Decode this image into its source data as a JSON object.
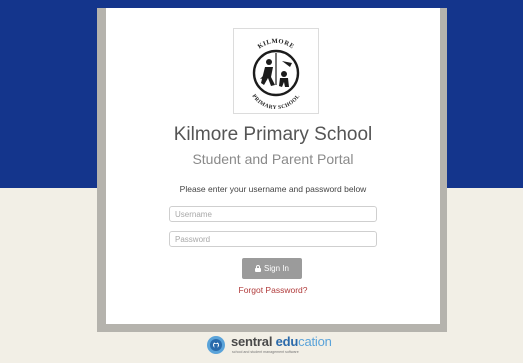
{
  "school": {
    "logo_lettering": [
      "KILMORE",
      "PRIMARY",
      "SCHOOL"
    ],
    "name": "Kilmore Primary School",
    "portal_title": "Student and Parent Portal"
  },
  "login": {
    "instructions": "Please enter your username and password below",
    "username_placeholder": "Username",
    "password_placeholder": "Password",
    "signin_label": "Sign In",
    "forgot_label": "Forgot Password?"
  },
  "footer": {
    "brand_part1": "sentral ",
    "brand_part2": "edu",
    "brand_part3": "cation",
    "tagline": "school and student management software"
  },
  "colors": {
    "header_band": "#14358c",
    "page_background": "#f2efe6",
    "card_frame": "#b5b3ad",
    "signin_button": "#9b9b9b",
    "forgot_link": "#b03a3a"
  },
  "icons": {
    "signin": "lock-icon",
    "school_logo": "school-crest-icon",
    "footer": "sentral-emblem-icon"
  }
}
